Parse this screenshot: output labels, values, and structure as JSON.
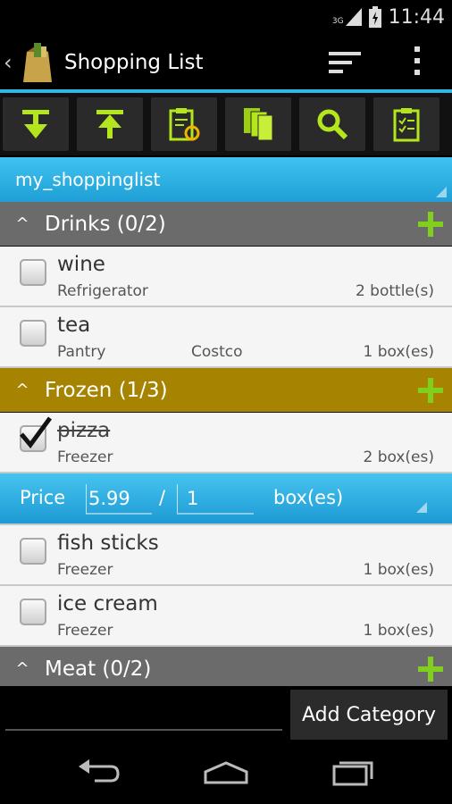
{
  "status_bar": {
    "network": "3G",
    "time": "11:44"
  },
  "action_bar": {
    "title": "Shopping List"
  },
  "toolbar": {
    "buttons": [
      {
        "icon": "arrow-down-to-bar-icon"
      },
      {
        "icon": "arrow-up-to-bar-icon"
      },
      {
        "icon": "clipboard-sync-icon"
      },
      {
        "icon": "copy-pages-icon"
      },
      {
        "icon": "search-icon"
      },
      {
        "icon": "clipboard-checklist-icon"
      }
    ]
  },
  "list_selector": {
    "value": "my_shoppinglist"
  },
  "categories": [
    {
      "title": "Drinks (0/2)",
      "items": [
        {
          "name": "wine",
          "location": "Refrigerator",
          "store": "",
          "quantity": "2 bottle(s)",
          "checked": false
        },
        {
          "name": "tea",
          "location": "Pantry",
          "store": "Costco",
          "quantity": "1 box(es)",
          "checked": false
        }
      ]
    },
    {
      "title": "Frozen (1/3)",
      "items": [
        {
          "name": "pizza",
          "location": "Freezer",
          "store": "",
          "quantity": "2 box(es)",
          "checked": true
        },
        {
          "name": "fish sticks",
          "location": "Freezer",
          "store": "",
          "quantity": "1 box(es)",
          "checked": false
        },
        {
          "name": "ice cream",
          "location": "Freezer",
          "store": "",
          "quantity": "1 box(es)",
          "checked": false
        }
      ]
    },
    {
      "title": "Meat (0/2)"
    }
  ],
  "price_editor": {
    "label": "Price",
    "price": "5.99",
    "separator": "/",
    "quantity": "1",
    "unit": "box(es)"
  },
  "bottom_bar": {
    "input_value": "",
    "add_category_label": "Add Category"
  },
  "colors": {
    "accent": "#33b5e5",
    "frozen_header": "#a68300",
    "default_header": "#6b6b6b",
    "plus": "#7fcf1c"
  }
}
